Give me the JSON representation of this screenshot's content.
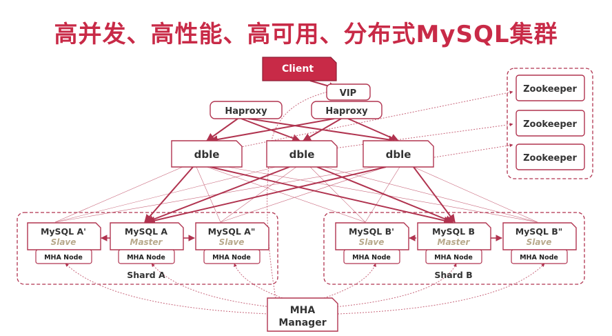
{
  "title": "高并发、高性能、高可用、分布式MySQL集群",
  "client": "Client",
  "vip": "VIP",
  "haproxy": [
    "Haproxy",
    "Haproxy"
  ],
  "dble": [
    "dble",
    "dble",
    "dble"
  ],
  "zookeeper": [
    "Zookeeper",
    "Zookeeper",
    "Zookeeper"
  ],
  "shards": [
    {
      "label": "Shard A",
      "nodes": [
        {
          "name": "MySQL A'",
          "role": "Slave",
          "mha": "MHA Node"
        },
        {
          "name": "MySQL A",
          "role": "Master",
          "mha": "MHA Node"
        },
        {
          "name": "MySQL A\"",
          "role": "Slave",
          "mha": "MHA Node"
        }
      ]
    },
    {
      "label": "Shard B",
      "nodes": [
        {
          "name": "MySQL B'",
          "role": "Slave",
          "mha": "MHA Node"
        },
        {
          "name": "MySQL B",
          "role": "Master",
          "mha": "MHA Node"
        },
        {
          "name": "MySQL B\"",
          "role": "Slave",
          "mha": "MHA Node"
        }
      ]
    }
  ],
  "mha_manager": [
    "MHA",
    "Manager"
  ],
  "colors": {
    "accent": "#c82a47",
    "client_fill": "#c82a47",
    "slave_text": "#b8a98c"
  }
}
